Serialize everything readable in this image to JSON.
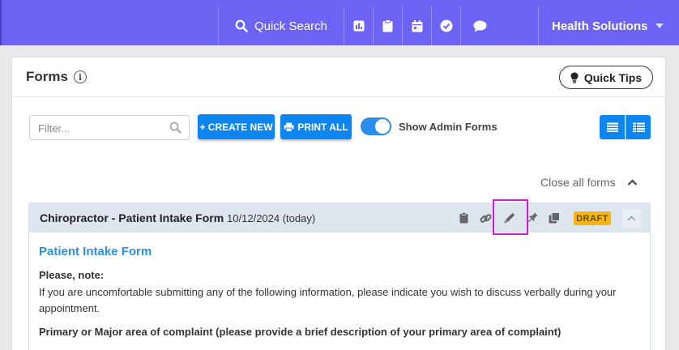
{
  "nav": {
    "search_label": "Quick Search",
    "icons": [
      "report-icon",
      "clipboard-icon",
      "calendar-icon",
      "check-circle-icon",
      "chat-icon"
    ],
    "org_label": "Health Solutions"
  },
  "page": {
    "title": "Forms",
    "quick_tips": "Quick Tips"
  },
  "toolbar": {
    "filter_placeholder": "Filter...",
    "create_new": "+ CREATE NEW",
    "print_all": "PRINT ALL",
    "show_admin_label": "Show Admin Forms",
    "show_admin_on": true
  },
  "close_all": "Close all forms",
  "form_panel": {
    "name": "Chiropractor - Patient Intake Form",
    "date": "10/12/2024 (today)",
    "status": "DRAFT",
    "form_title": "Patient Intake Form",
    "note_label": "Please, note:",
    "note_text": "If you are uncomfortable submitting any of the following information, please indicate you wish to discuss verbally during your appointment.",
    "complaint_label": "Primary or Major area of complaint (please provide a brief description of your primary area of complaint)"
  },
  "colors": {
    "nav_bg": "#6c63f5",
    "primary": "#0d86f2",
    "draft": "#f6b60f",
    "highlight": "#d41ad4",
    "form_title": "#2e8fe0"
  }
}
